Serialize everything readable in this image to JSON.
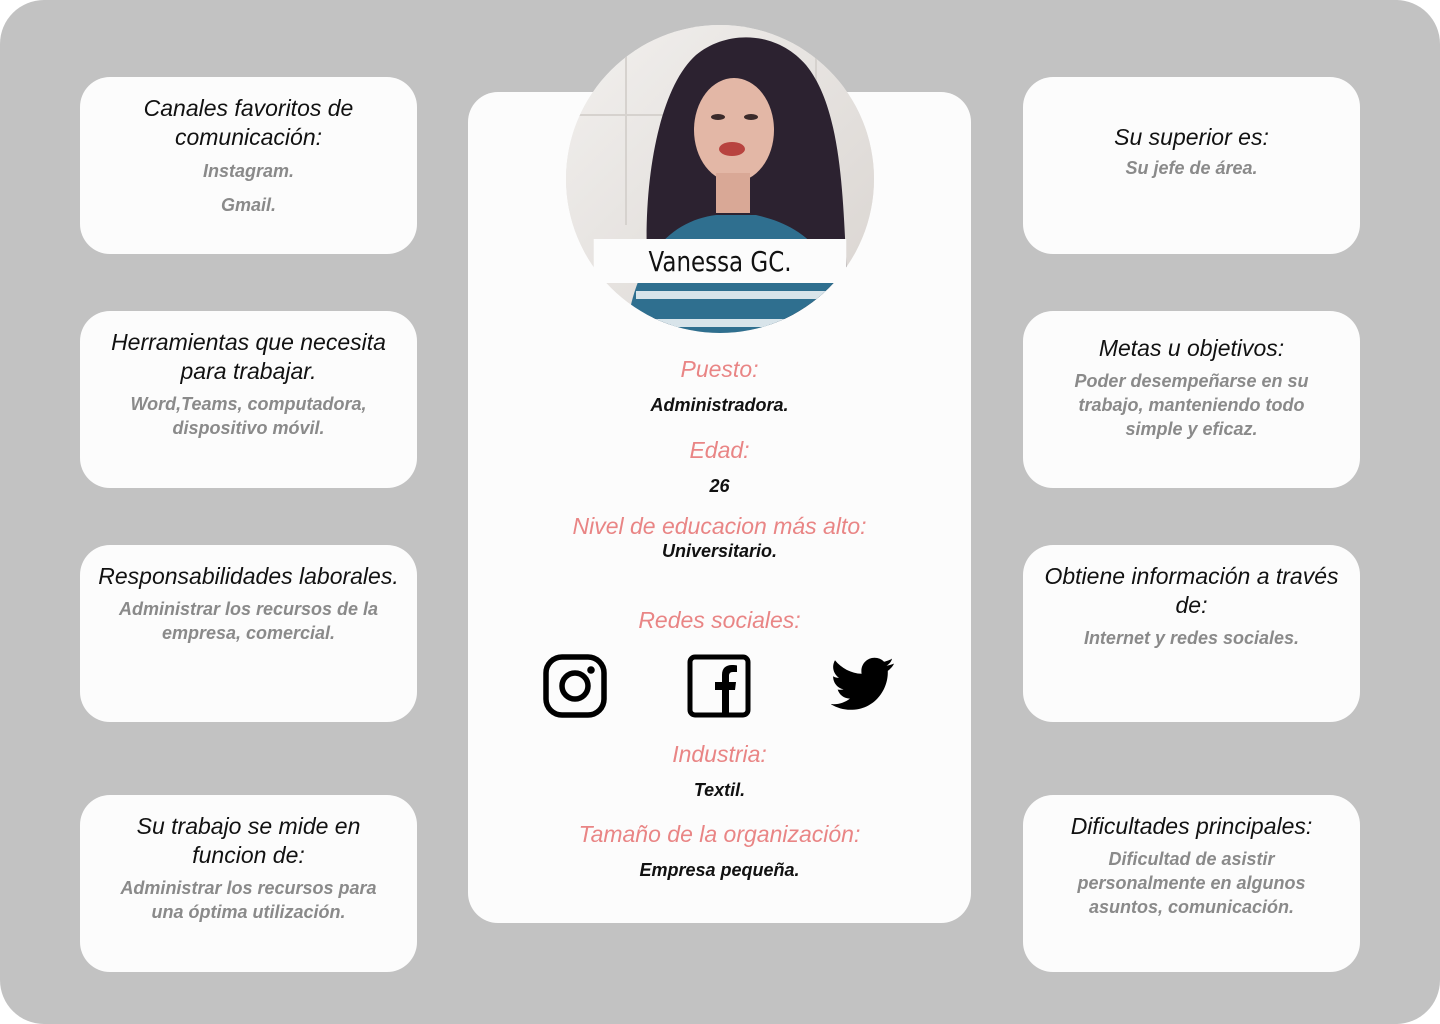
{
  "profile": {
    "name": "Vanessa GC.",
    "puesto_label": "Puesto:",
    "puesto_value": "Administradora.",
    "edad_label": "Edad:",
    "edad_value": "26",
    "educacion_label": "Nivel de educacion más alto:",
    "educacion_value": "Universitario.",
    "redes_label": "Redes sociales:",
    "social_icons": [
      "instagram-icon",
      "facebook-icon",
      "twitter-icon"
    ],
    "industria_label": "Industria:",
    "industria_value": "Textil.",
    "tamano_label": "Tamaño de la organización:",
    "tamano_value": "Empresa pequeña."
  },
  "left_cards": [
    {
      "title": "Canales favoritos de comunicación:",
      "body": [
        "Instagram.",
        "Gmail."
      ]
    },
    {
      "title": "Herramientas que necesita para trabajar.",
      "body": [
        "Word,Teams, computadora,",
        "dispositivo móvil."
      ]
    },
    {
      "title": "Responsabilidades laborales.",
      "body": [
        "Administrar los recursos de la",
        "empresa, comercial."
      ]
    },
    {
      "title": "Su trabajo se mide en funcion de:",
      "body": [
        "Administrar los recursos para",
        "una óptima utilización."
      ]
    }
  ],
  "right_cards": [
    {
      "title": "Su superior es:",
      "body": [
        "Su jefe de área."
      ]
    },
    {
      "title": "Metas u objetivos:",
      "body": [
        "Poder desempeñarse en su",
        "trabajo, manteniendo todo",
        "simple y eficaz."
      ]
    },
    {
      "title": "Obtiene información a través de:",
      "body": [
        "Internet y redes sociales."
      ]
    },
    {
      "title": "Dificultades principales:",
      "body": [
        "Dificultad de asistir",
        "personalmente en algunos",
        "asuntos, comunicación."
      ]
    }
  ],
  "colors": {
    "background": "#c2c2c2",
    "card": "#fcfcfc",
    "accent_label": "#e98585",
    "muted_text": "#8a8a8a",
    "text": "#111111"
  }
}
